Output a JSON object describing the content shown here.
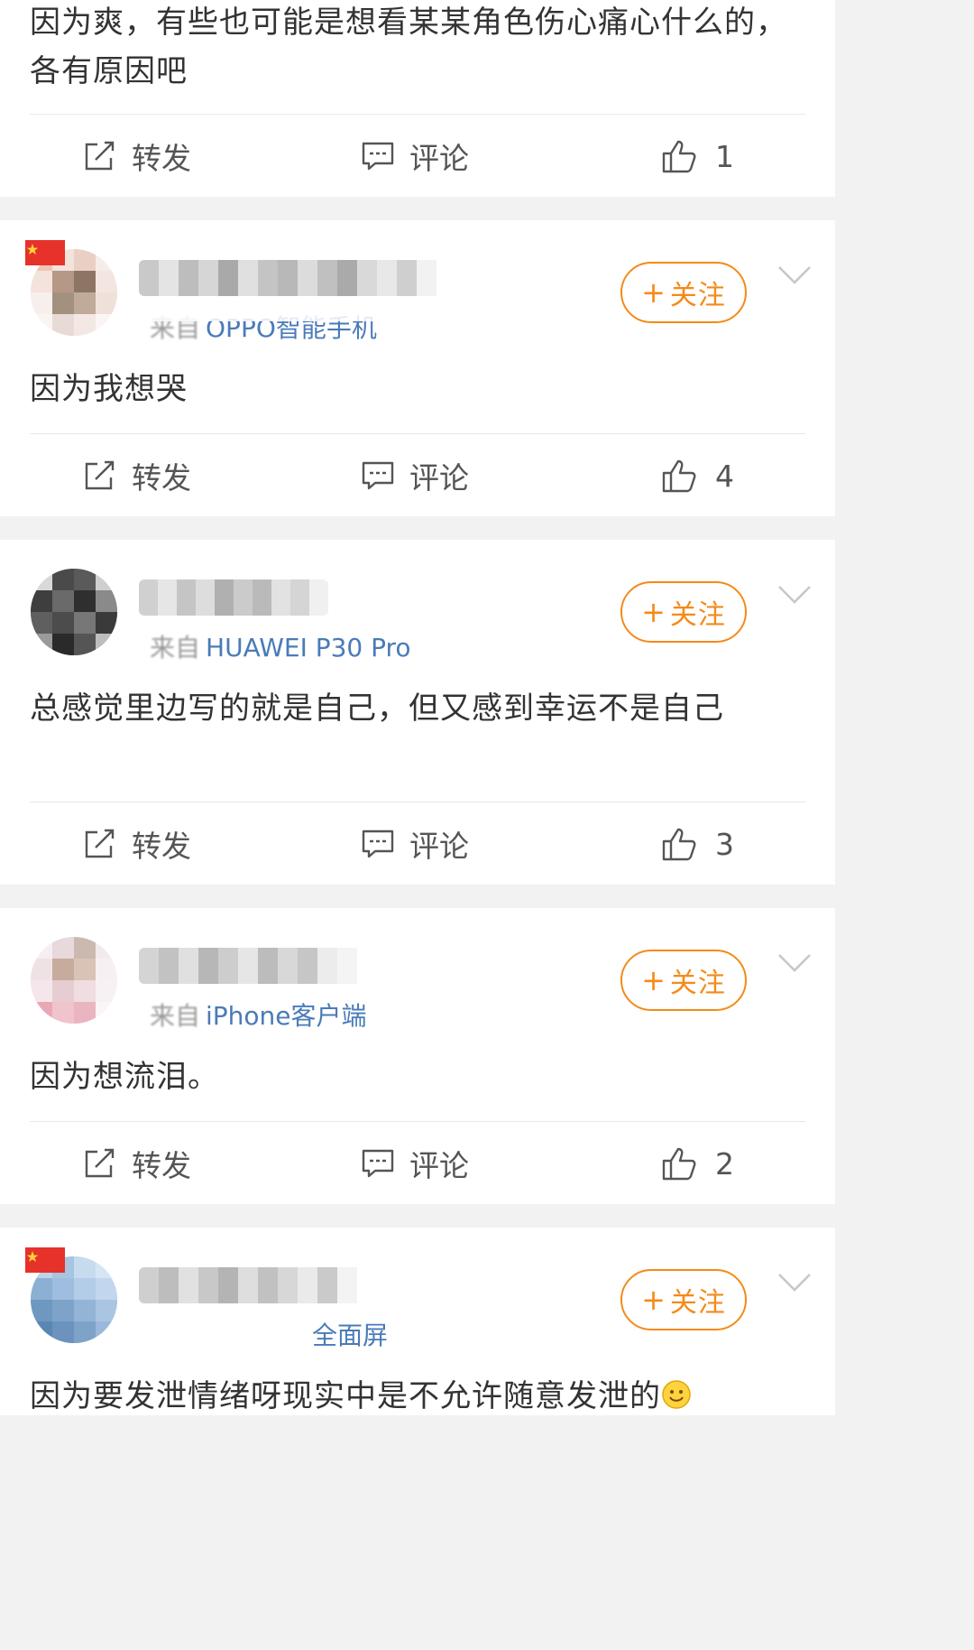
{
  "actions": {
    "repost_label": "转发",
    "comment_label": "评论"
  },
  "follow": {
    "plus": "+",
    "label": "关注"
  },
  "posts": [
    {
      "content": "因为爽，有些也可能是想看某某角色伤心痛心什么的，各有原因吧",
      "likes": "1"
    },
    {
      "source_prefix": "来自",
      "source": "OPPO智能手机",
      "content": "因为我想哭",
      "likes": "4"
    },
    {
      "source_prefix": "来自",
      "source": "HUAWEI P30 Pro",
      "content": "总感觉里边写的就是自己，但又感到幸运不是自己",
      "likes": "3"
    },
    {
      "source_prefix": "来自",
      "source": "iPhone客户端",
      "content": "因为想流泪。",
      "likes": "2"
    },
    {
      "source": "全面屏",
      "content": "因为要发泄情绪呀现实中是不允许随意发泄的"
    }
  ],
  "icons": {
    "repost": "edit-share-icon",
    "comment": "comment-icon",
    "like": "thumbs-up-icon",
    "more": "chevron-down-icon",
    "flag": "china-flag-icon",
    "emoji": "smile-emoji-icon"
  },
  "colors": {
    "accent": "#f58a18",
    "source_link": "#4a7bb8",
    "separator": "#f2f2f2"
  }
}
